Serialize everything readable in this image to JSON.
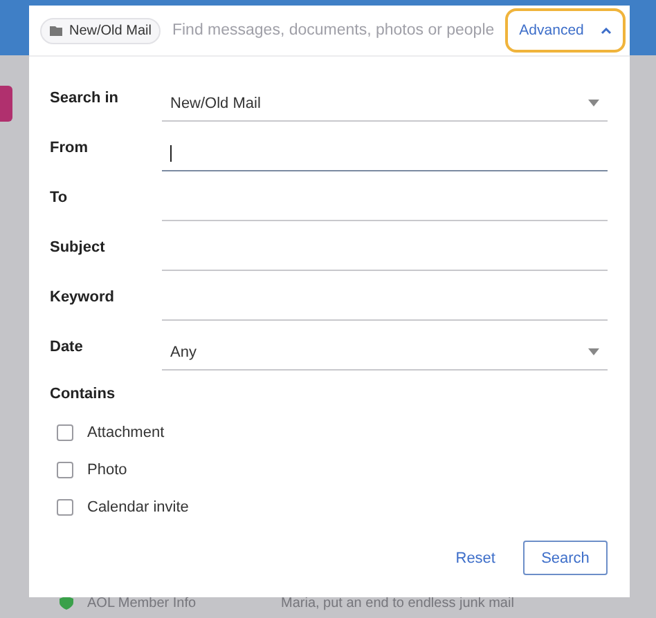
{
  "search_bar": {
    "scope_chip": "New/Old Mail",
    "placeholder": "Find messages, documents, photos or people",
    "advanced_button": {
      "label": "Advanced",
      "expanded": true
    }
  },
  "fields": [
    {
      "label": "Search in",
      "kind": "select",
      "value": "New/Old Mail",
      "focused": false
    },
    {
      "label": "From",
      "kind": "text",
      "focused": true
    },
    {
      "label": "To",
      "kind": "text",
      "focused": false
    },
    {
      "label": "Subject",
      "kind": "text",
      "focused": false
    },
    {
      "label": "Keyword",
      "kind": "text",
      "focused": false
    },
    {
      "label": "Date",
      "kind": "select",
      "value": "Any",
      "focused": false
    }
  ],
  "contains": {
    "label": "Contains",
    "options": [
      {
        "label": "Attachment",
        "checked": false
      },
      {
        "label": "Photo",
        "checked": false
      },
      {
        "label": "Calendar invite",
        "checked": false
      }
    ]
  },
  "buttons": {
    "reset": "Reset",
    "search": "Search"
  },
  "background_message": {
    "sender": "AOL Member Info",
    "subject": "Maria, put an end to endless junk mail"
  }
}
